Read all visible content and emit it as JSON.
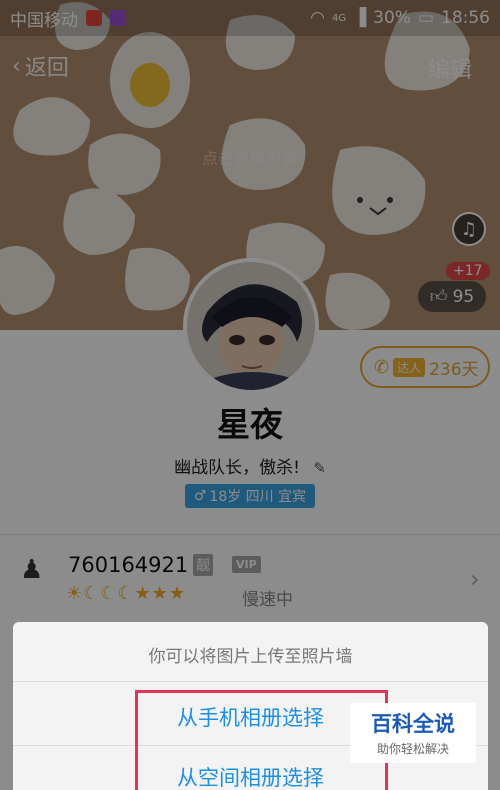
{
  "status_bar": {
    "carrier": "中国移动",
    "network": "4G",
    "battery": "30%",
    "time": "18:56",
    "app_badge_colors": [
      "#e8463c",
      "#9b4fd6"
    ]
  },
  "nav": {
    "back_label": "返回",
    "edit_label": "编辑"
  },
  "cover": {
    "hint": "点击更换封面",
    "bg_color": "#b28e6d"
  },
  "likes": {
    "new_count": "+17",
    "total": "95"
  },
  "daren": {
    "tag": "达人",
    "days": "236天"
  },
  "profile": {
    "nickname": "星夜",
    "signature": "幽战队长，傲杀!",
    "info_chip": "18岁 四川 宜宾"
  },
  "qq": {
    "number": "760164921",
    "liang_badge": "靓",
    "vip_badge": "VIP",
    "level_icons": "☀☾☾☾★★★",
    "speed_text": "慢速中"
  },
  "sheet": {
    "title": "你可以将图片上传至照片墙",
    "option_phone": "从手机相册选择",
    "option_space": "从空间相册选择",
    "accent_color": "#1e8fe0"
  },
  "watermark": {
    "title": "百科全说",
    "subtitle": "助你轻松解决"
  }
}
